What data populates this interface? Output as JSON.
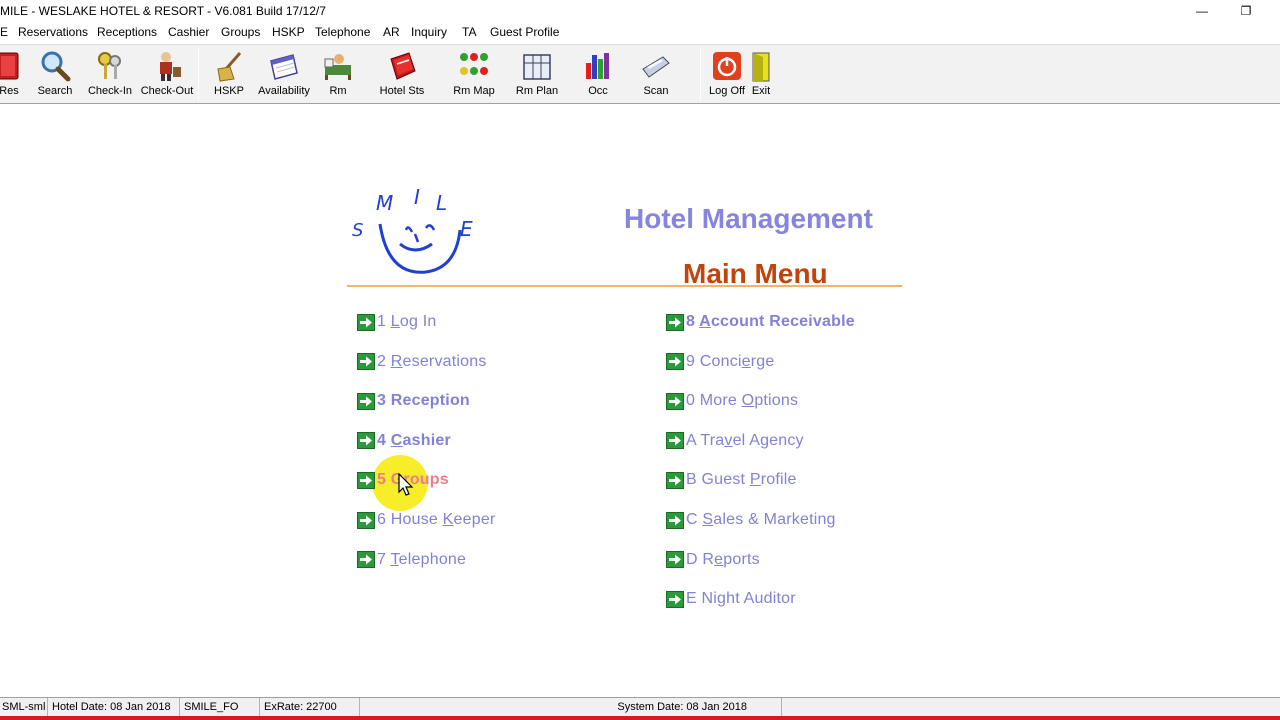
{
  "window": {
    "title": "MILE - WESLAKE HOTEL & RESORT - V6.081 Build 17/12/7",
    "minimize_glyph": "—",
    "restore_glyph": "❐"
  },
  "menubar": [
    "E",
    "Reservations",
    "Receptions",
    "Cashier",
    "Groups",
    "HSKP",
    "Telephone",
    "AR",
    "Inquiry",
    "TA",
    "Guest Profile"
  ],
  "toolbar": [
    {
      "label": "Res",
      "icon": "reservation-book-icon"
    },
    {
      "label": "Search",
      "icon": "magnifier-icon"
    },
    {
      "label": "Check-In",
      "icon": "keys-icon"
    },
    {
      "label": "Check-Out",
      "icon": "bellboy-icon"
    },
    {
      "label": "HSKP",
      "icon": "broom-icon"
    },
    {
      "label": "Availability",
      "icon": "calendar-icon"
    },
    {
      "label": "Rm",
      "icon": "bed-icon"
    },
    {
      "label": "Hotel Sts",
      "icon": "red-book-icon"
    },
    {
      "label": "Rm Map",
      "icon": "room-map-icon"
    },
    {
      "label": "Rm Plan",
      "icon": "room-plan-icon"
    },
    {
      "label": "Occ",
      "icon": "bar-chart-icon"
    },
    {
      "label": "Scan",
      "icon": "scanner-icon"
    },
    {
      "label": "Log Off",
      "icon": "power-icon"
    },
    {
      "label": "Exit",
      "icon": "exit-door-icon"
    }
  ],
  "main": {
    "logo_text": [
      "S",
      "M",
      "I",
      "L",
      "E"
    ],
    "app_title": "Hotel Management",
    "menu_title": "Main Menu",
    "left_items": [
      {
        "key": "1",
        "pre": " ",
        "accel": "L",
        "post": "og In",
        "bold": false
      },
      {
        "key": "2",
        "pre": " ",
        "accel": "R",
        "post": "eservations",
        "bold": false
      },
      {
        "key": "3",
        "pre": " Reception",
        "accel": "",
        "post": "",
        "bold": true
      },
      {
        "key": "4",
        "pre": " ",
        "accel": "C",
        "post": "ashier",
        "bold": true
      },
      {
        "key": "5",
        "pre": " Groups",
        "accel": "",
        "post": "",
        "bold": true
      },
      {
        "key": "6",
        "pre": " House ",
        "accel": "K",
        "post": "eeper",
        "bold": false
      },
      {
        "key": "7",
        "pre": " ",
        "accel": "T",
        "post": "elephone",
        "bold": false
      }
    ],
    "right_items": [
      {
        "key": "8",
        "pre": " ",
        "accel": "A",
        "post": "ccount Receivable",
        "bold": true
      },
      {
        "key": "9",
        "pre": " Conci",
        "accel": "e",
        "post": "rge",
        "bold": false
      },
      {
        "key": "0",
        "pre": " More ",
        "accel": "O",
        "post": "ptions",
        "bold": false
      },
      {
        "key": "A",
        "pre": " Tra",
        "accel": "v",
        "post": "el Agency",
        "bold": false
      },
      {
        "key": "B",
        "pre": " Guest ",
        "accel": "P",
        "post": "rofile",
        "bold": false
      },
      {
        "key": "C",
        "pre": " ",
        "accel": "S",
        "post": "ales & Marketing",
        "bold": false
      },
      {
        "key": "D",
        "pre": " R",
        "accel": "e",
        "post": "ports",
        "bold": false
      },
      {
        "key": "E",
        "pre": " Night Auditor",
        "accel": "",
        "post": "",
        "bold": false
      }
    ]
  },
  "statusbar": {
    "user": "SML-sml",
    "hotel_date": "Hotel Date: 08 Jan 2018",
    "station": "SMILE_FO",
    "exrate": "ExRate: 22700",
    "system_date": "System Date: 08 Jan 2018"
  },
  "colors": {
    "link": "#8181d8",
    "title_blue": "#8585e0",
    "title_orange": "#c0440c",
    "highlight": "#f6ec17",
    "status_red": "#e4141b"
  }
}
